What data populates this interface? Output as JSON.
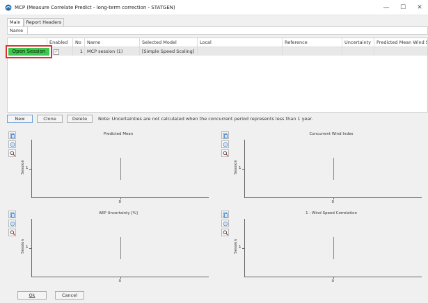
{
  "window": {
    "title": "MCP (Measure Correlate Predict - long-term correction - STATGEN)",
    "minimize_glyph": "—",
    "maximize_glyph": "☐",
    "close_glyph": "✕"
  },
  "tabs": [
    {
      "label": "Main",
      "active": true
    },
    {
      "label": "Report Headers",
      "active": false
    }
  ],
  "name_field": {
    "label": "Name",
    "value": ""
  },
  "grid": {
    "columns": [
      "",
      "Enabled",
      "No",
      "Name",
      "Selected Model",
      "Local",
      "Reference",
      "Uncertainty",
      "Predicted Mean Wind S"
    ],
    "rows": [
      {
        "no": "1",
        "name": "MCP session (1)",
        "model": "[Simple Speed Scaling]",
        "enabled": true
      }
    ]
  },
  "open_session_label": "Open Session",
  "actions": {
    "new_label": "New",
    "clone_label": "Clone",
    "delete_label": "Delete",
    "note": "Note: Uncertainties are not calculated when the concurrent period represents less than 1 year."
  },
  "charts": [
    {
      "title": "Predicted Mean",
      "ylabel": "Session",
      "ytick": "1",
      "xtick": "0"
    },
    {
      "title": "Concurrent Wind Index",
      "ylabel": "Session",
      "ytick": "1",
      "xtick": "0"
    },
    {
      "title": "AEP Uncertainty [%]",
      "ylabel": "Session",
      "ytick": "1",
      "xtick": "0"
    },
    {
      "title": "1 - Wind Speed Correlation",
      "ylabel": "Session",
      "ytick": "1",
      "xtick": "0"
    }
  ],
  "chart_data": [
    {
      "type": "bar",
      "title": "Predicted Mean",
      "ylabel": "Session",
      "categories": [
        "1"
      ],
      "values": [
        0
      ]
    },
    {
      "type": "bar",
      "title": "Concurrent Wind Index",
      "ylabel": "Session",
      "categories": [
        "1"
      ],
      "values": [
        0
      ]
    },
    {
      "type": "bar",
      "title": "AEP Uncertainty [%]",
      "ylabel": "Session",
      "categories": [
        "1"
      ],
      "values": [
        0
      ]
    },
    {
      "type": "bar",
      "title": "1 - Wind Speed Correlation",
      "ylabel": "Session",
      "categories": [
        "1"
      ],
      "values": [
        0
      ]
    }
  ],
  "footer": {
    "ok_label": "Ok",
    "cancel_label": "Cancel"
  },
  "colors": {
    "open_session": "#3cc94e",
    "highlight_border": "#e03030"
  }
}
